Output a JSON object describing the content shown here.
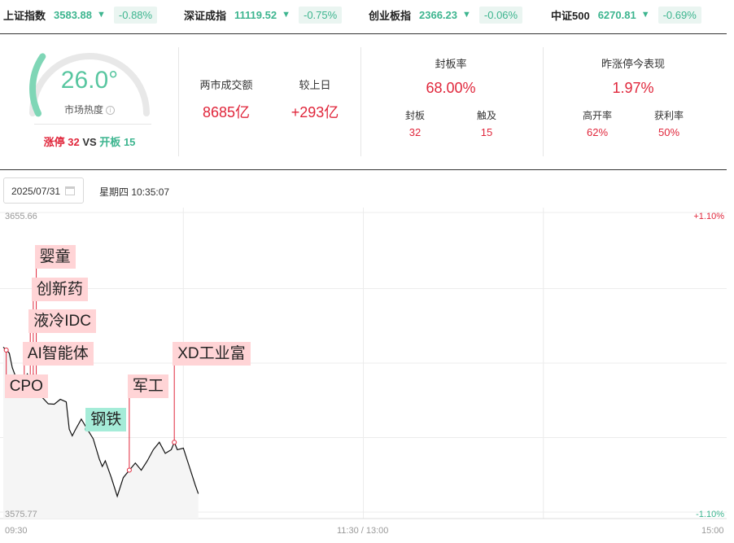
{
  "indices": [
    {
      "name": "上证指数",
      "value": "3583.88",
      "arrow": "▼",
      "change": "-0.88%"
    },
    {
      "name": "深证成指",
      "value": "11119.52",
      "arrow": "▼",
      "change": "-0.75%"
    },
    {
      "name": "创业板指",
      "value": "2366.23",
      "arrow": "▼",
      "change": "-0.06%"
    },
    {
      "name": "中证500",
      "value": "6270.81",
      "arrow": "▼",
      "change": "-0.69%"
    }
  ],
  "heat": {
    "value": "26.0°",
    "level": 26.0,
    "label": "市场热度",
    "info_icon": "ⓘ",
    "limit_up_label": "涨停",
    "limit_up_count": "32",
    "vs": "VS",
    "open_label": "开板",
    "open_count": "15"
  },
  "turnover": {
    "label": "两市成交额",
    "value": "8685亿",
    "prev_label": "较上日",
    "prev_value": "+293亿"
  },
  "seal": {
    "label": "封板率",
    "value": "68.00%",
    "sealed_label": "封板",
    "sealed_value": "32",
    "touched_label": "触及",
    "touched_value": "15"
  },
  "yesterday": {
    "label": "昨涨停今表现",
    "value": "1.97%",
    "high_open_label": "高开率",
    "high_open_value": "62%",
    "profit_label": "获利率",
    "profit_value": "50%"
  },
  "date_picker": {
    "value": "2025/07/31",
    "icon": "calendar-icon"
  },
  "datetime": "星期四 10:35:07",
  "chart_data": {
    "type": "line",
    "ylim": [
      3575.77,
      3655.66
    ],
    "y_top_label": "3655.66",
    "y_bottom_label": "3575.77",
    "right_top_label": "+1.10%",
    "right_bottom_label": "-1.10%",
    "x_labels": [
      "09:30",
      "11:30 / 13:00",
      "15:00"
    ],
    "series": [
      {
        "x": [
          "09:30",
          "09:31",
          "09:32",
          "09:33",
          "09:35",
          "09:36",
          "09:37",
          "09:38",
          "09:39",
          "09:40",
          "09:41",
          "09:43",
          "09:45",
          "09:47",
          "09:49",
          "09:51",
          "09:52",
          "09:53",
          "09:54",
          "09:56",
          "09:58",
          "10:00",
          "10:02",
          "10:03",
          "10:04",
          "10:06",
          "10:08",
          "10:10",
          "10:12",
          "10:14",
          "10:16",
          "10:18",
          "10:20",
          "10:22",
          "10:24",
          "10:26",
          "10:27",
          "10:28",
          "10:30",
          "10:32",
          "10:33",
          "10:34",
          "10:35"
        ],
        "values": [
          3620.0,
          3619.2,
          3618.4,
          3614.5,
          3610.2,
          3608.0,
          3610.0,
          3612.8,
          3611.6,
          3612.1,
          3609.8,
          3606.5,
          3604.8,
          3604.7,
          3606.0,
          3605.3,
          3598.0,
          3596.2,
          3597.8,
          3600.7,
          3598.0,
          3595.4,
          3590.0,
          3588.0,
          3589.5,
          3585.0,
          3580.0,
          3585.0,
          3587.0,
          3588.9,
          3587.0,
          3589.5,
          3592.5,
          3594.5,
          3591.5,
          3592.5,
          3594.5,
          3592.5,
          3592.9,
          3588.0,
          3585.5,
          3583.0,
          3580.7
        ]
      }
    ],
    "annotations": [
      {
        "label": "CPO",
        "time": "09:31",
        "color": "red"
      },
      {
        "label": "AI智能体",
        "time": "09:37",
        "color": "red"
      },
      {
        "label": "液冷IDC",
        "time": "09:39",
        "color": "red"
      },
      {
        "label": "创新药",
        "time": "09:40",
        "color": "red"
      },
      {
        "label": "婴童",
        "time": "09:41",
        "color": "red"
      },
      {
        "label": "钢铁",
        "time": "09:58",
        "color": "green"
      },
      {
        "label": "军工",
        "time": "10:12",
        "color": "red"
      },
      {
        "label": "XD工业富",
        "time": "10:27",
        "color": "red"
      }
    ]
  },
  "colors": {
    "up": "#e0263b",
    "down": "#3db58f",
    "tag_red": "#ffd4d6",
    "tag_green": "#a5ecd8"
  }
}
